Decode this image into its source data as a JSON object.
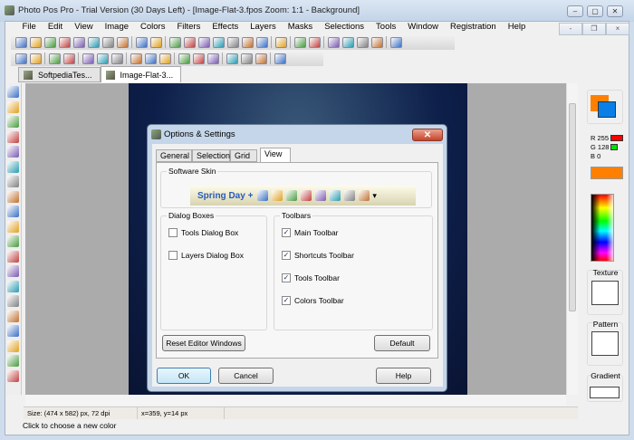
{
  "window": {
    "title": "Photo Pos Pro - Trial Version (30 Days Left) - [Image-Flat-3.fpos  Zoom: 1:1 - Background]",
    "min": "–",
    "max": "▢",
    "close": "✕",
    "mdi_min": "-",
    "mdi_restore": "❐",
    "mdi_close": "×"
  },
  "menu": [
    "File",
    "Edit",
    "View",
    "Image",
    "Colors",
    "Filters",
    "Effects",
    "Layers",
    "Masks",
    "Selections",
    "Tools",
    "Window",
    "Registration",
    "Help"
  ],
  "toolbar1": [
    "new",
    "open",
    "grid",
    "save",
    "save-as",
    "print",
    "print-setup",
    "scan",
    "|",
    "undo",
    "redo",
    "|",
    "cut",
    "copy",
    "paste",
    "paste-new",
    "paste-layer",
    "paste-into",
    "monitor",
    "|",
    "clipboard",
    "|",
    "tools",
    "layers",
    "|",
    "table",
    "resize",
    "window",
    "ruler",
    "|",
    "zoom"
  ],
  "toolbar2": [
    "rotate-left",
    "rotate-right",
    "|",
    "flip-h",
    "flip-v",
    "|",
    "contrast",
    "hue",
    "brightness",
    "|",
    "layer-up",
    "layer-down",
    "red-eye",
    "|",
    "histogram",
    "levels",
    "curves",
    "|",
    "frame",
    "effects",
    "picture",
    "|",
    "diamond"
  ],
  "doc_tabs": [
    {
      "label": "SoftpediaTes...",
      "active": false
    },
    {
      "label": "Image-Flat-3...",
      "active": true
    }
  ],
  "tools": [
    "pointer",
    "zoom",
    "move",
    "rect-select",
    "lasso",
    "magic-wand",
    "crop",
    "eyedropper",
    "brush",
    "pencil",
    "airbrush",
    "clone",
    "gradient",
    "fill",
    "text",
    "shapes",
    "eraser",
    "smudge",
    "heal",
    "dodge"
  ],
  "status": {
    "size": "Size: (474 x 582) px, 72 dpi",
    "coords": "x=359, y=14 px",
    "hint": "Click to choose a new color"
  },
  "colors": {
    "fg": "#ff8000",
    "bg": "#0a7fe8",
    "r_label": "R 255",
    "g_label": "G 128",
    "b_label": "B 0",
    "r": "#ff0000",
    "g": "#00e000",
    "texture": "Texture",
    "pattern": "Pattern",
    "gradient": "Gradient"
  },
  "dialog": {
    "title": "Options & Settings",
    "close": "✕",
    "tabs": [
      {
        "label": "General",
        "active": false
      },
      {
        "label": "Selection",
        "active": false
      },
      {
        "label": "Grid",
        "active": false
      },
      {
        "label": "View",
        "active": true
      }
    ],
    "skin_group": "Software Skin",
    "skin_name": "Spring Day +",
    "dropdown": "▾",
    "dialog_group": "Dialog Boxes",
    "dialog_items": [
      {
        "label": "Tools Dialog Box",
        "checked": false
      },
      {
        "label": "Layers Dialog Box",
        "checked": false
      }
    ],
    "toolbars_group": "Toolbars",
    "toolbar_items": [
      {
        "label": "Main Toolbar",
        "checked": true
      },
      {
        "label": "Shortcuts Toolbar",
        "checked": true
      },
      {
        "label": "Tools Toolbar",
        "checked": true
      },
      {
        "label": "Colors Toolbar",
        "checked": true
      }
    ],
    "reset": "Reset Editor Windows",
    "default": "Default",
    "ok": "OK",
    "cancel": "Cancel",
    "help": "Help",
    "check": "✓"
  }
}
